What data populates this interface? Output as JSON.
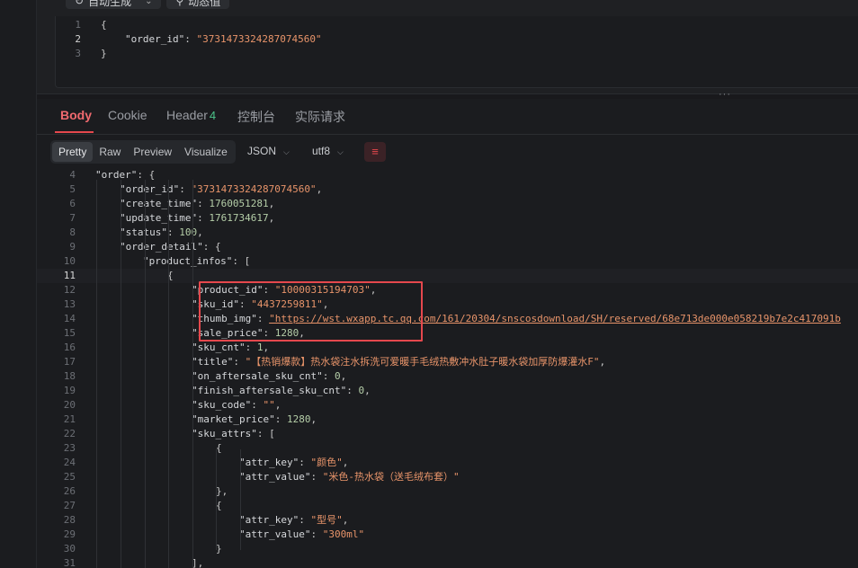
{
  "request": {
    "toolbar": {
      "auto_generate_label": "自动生成",
      "dynamic_value_label": "动态值"
    },
    "lines": [
      {
        "n": "1",
        "text": "{"
      },
      {
        "n": "2",
        "key": "\"order_id\"",
        "value": "\"3731473324287074560\""
      },
      {
        "n": "3",
        "text": "}"
      }
    ]
  },
  "response": {
    "tabs": [
      {
        "label": "Body",
        "active": true
      },
      {
        "label": "Cookie"
      },
      {
        "label": "Header",
        "count": "4"
      },
      {
        "label": "控制台"
      },
      {
        "label": "实际请求"
      }
    ],
    "view_modes": [
      "Pretty",
      "Raw",
      "Preview",
      "Visualize"
    ],
    "active_view": "Pretty",
    "format": "JSON",
    "encoding": "utf8",
    "body_lines": [
      {
        "n": "4",
        "indent": 1,
        "key": "\"order\"",
        "value": "{",
        "vtype": "p"
      },
      {
        "n": "5",
        "indent": 2,
        "key": "\"order_id\"",
        "value": "\"3731473324287074560\"",
        "vtype": "s",
        "comma": true
      },
      {
        "n": "6",
        "indent": 2,
        "key": "\"create_time\"",
        "value": "1760051281",
        "vtype": "n",
        "comma": true
      },
      {
        "n": "7",
        "indent": 2,
        "key": "\"update_time\"",
        "value": "1761734617",
        "vtype": "n",
        "comma": true
      },
      {
        "n": "8",
        "indent": 2,
        "key": "\"status\"",
        "value": "100",
        "vtype": "n",
        "comma": true
      },
      {
        "n": "9",
        "indent": 2,
        "key": "\"order_detail\"",
        "value": "{",
        "vtype": "p"
      },
      {
        "n": "10",
        "indent": 3,
        "key": "\"product_infos\"",
        "value": "[",
        "vtype": "p"
      },
      {
        "n": "11",
        "indent": 4,
        "text": "{",
        "current": true
      },
      {
        "n": "12",
        "indent": 5,
        "key": "\"product_id\"",
        "value": "\"10000315194703\"",
        "vtype": "s",
        "comma": true
      },
      {
        "n": "13",
        "indent": 5,
        "key": "\"sku_id\"",
        "value": "\"4437259811\"",
        "vtype": "s",
        "comma": true
      },
      {
        "n": "14",
        "indent": 5,
        "key": "\"thumb_img\"",
        "value": "\"https://wst.wxapp.tc.qq.com/161/20304/snscosdownload/SH/reserved/68e713de000e058219b7e2c417091b",
        "vtype": "u"
      },
      {
        "n": "15",
        "indent": 5,
        "key": "\"sale_price\"",
        "value": "1280",
        "vtype": "n",
        "comma": true
      },
      {
        "n": "16",
        "indent": 5,
        "key": "\"sku_cnt\"",
        "value": "1",
        "vtype": "n",
        "comma": true
      },
      {
        "n": "17",
        "indent": 5,
        "key": "\"title\"",
        "value": "\"【热销爆款】热水袋注水拆洗可爱暖手毛绒热敷冲水肚子暖水袋加厚防爆灌水F\"",
        "vtype": "s",
        "comma": true
      },
      {
        "n": "18",
        "indent": 5,
        "key": "\"on_aftersale_sku_cnt\"",
        "value": "0",
        "vtype": "n",
        "comma": true
      },
      {
        "n": "19",
        "indent": 5,
        "key": "\"finish_aftersale_sku_cnt\"",
        "value": "0",
        "vtype": "n",
        "comma": true
      },
      {
        "n": "20",
        "indent": 5,
        "key": "\"sku_code\"",
        "value": "\"\"",
        "vtype": "s",
        "comma": true
      },
      {
        "n": "21",
        "indent": 5,
        "key": "\"market_price\"",
        "value": "1280",
        "vtype": "n",
        "comma": true
      },
      {
        "n": "22",
        "indent": 5,
        "key": "\"sku_attrs\"",
        "value": "[",
        "vtype": "p"
      },
      {
        "n": "23",
        "indent": 6,
        "text": "{"
      },
      {
        "n": "24",
        "indent": 7,
        "key": "\"attr_key\"",
        "value": "\"颜色\"",
        "vtype": "s",
        "comma": true
      },
      {
        "n": "25",
        "indent": 7,
        "key": "\"attr_value\"",
        "value": "\"米色-热水袋（送毛绒布套）\"",
        "vtype": "s"
      },
      {
        "n": "26",
        "indent": 6,
        "text": "},"
      },
      {
        "n": "27",
        "indent": 6,
        "text": "{"
      },
      {
        "n": "28",
        "indent": 7,
        "key": "\"attr_key\"",
        "value": "\"型号\"",
        "vtype": "s",
        "comma": true
      },
      {
        "n": "29",
        "indent": 7,
        "key": "\"attr_value\"",
        "value": "\"300ml\"",
        "vtype": "s"
      },
      {
        "n": "30",
        "indent": 6,
        "text": "}"
      },
      {
        "n": "31",
        "indent": 5,
        "text": "],"
      }
    ]
  },
  "colors": {
    "accent": "#e5484d",
    "string": "#e8946a",
    "number": "#b5cea8",
    "badge": "#4cc38a"
  }
}
